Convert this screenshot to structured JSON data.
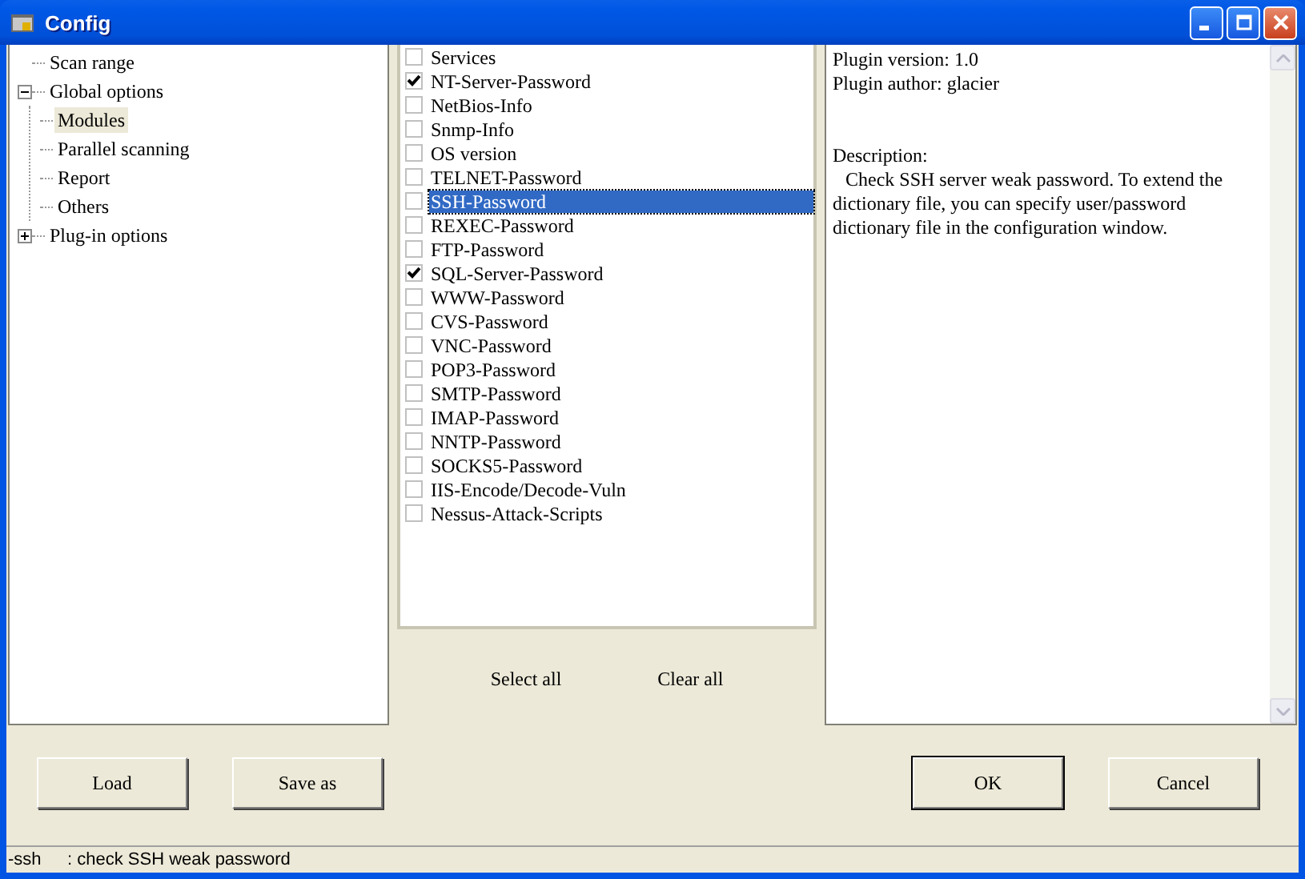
{
  "window": {
    "title": "Config"
  },
  "tree": [
    {
      "label": "Scan range",
      "selected": false
    },
    {
      "label": "Global options",
      "selected": false,
      "expanded": true,
      "children": [
        {
          "label": "Modules",
          "selected": true
        },
        {
          "label": "Parallel scanning",
          "selected": false
        },
        {
          "label": "Report",
          "selected": false
        },
        {
          "label": "Others",
          "selected": false
        }
      ]
    },
    {
      "label": "Plug-in options",
      "selected": false,
      "expanded": false
    }
  ],
  "modules": [
    {
      "label": "Services",
      "checked": false,
      "selected": false
    },
    {
      "label": "NT-Server-Password",
      "checked": true,
      "selected": false
    },
    {
      "label": "NetBios-Info",
      "checked": false,
      "selected": false
    },
    {
      "label": "Snmp-Info",
      "checked": false,
      "selected": false
    },
    {
      "label": "OS version",
      "checked": false,
      "selected": false
    },
    {
      "label": "TELNET-Password",
      "checked": false,
      "selected": false
    },
    {
      "label": "SSH-Password",
      "checked": false,
      "selected": true
    },
    {
      "label": "REXEC-Password",
      "checked": false,
      "selected": false
    },
    {
      "label": "FTP-Password",
      "checked": false,
      "selected": false
    },
    {
      "label": "SQL-Server-Password",
      "checked": true,
      "selected": false
    },
    {
      "label": "WWW-Password",
      "checked": false,
      "selected": false
    },
    {
      "label": "CVS-Password",
      "checked": false,
      "selected": false
    },
    {
      "label": "VNC-Password",
      "checked": false,
      "selected": false
    },
    {
      "label": "POP3-Password",
      "checked": false,
      "selected": false
    },
    {
      "label": "SMTP-Password",
      "checked": false,
      "selected": false
    },
    {
      "label": "IMAP-Password",
      "checked": false,
      "selected": false
    },
    {
      "label": "NNTP-Password",
      "checked": false,
      "selected": false
    },
    {
      "label": "SOCKS5-Password",
      "checked": false,
      "selected": false
    },
    {
      "label": "IIS-Encode/Decode-Vuln",
      "checked": false,
      "selected": false
    },
    {
      "label": "Nessus-Attack-Scripts",
      "checked": false,
      "selected": false
    }
  ],
  "list_buttons": [
    "Select all",
    "Clear all"
  ],
  "info": {
    "version": "Plugin version: 1.0",
    "author": "Plugin author: glacier",
    "description_label": "Description:",
    "description": "Check SSH server weak password. To extend the dictionary file, you can specify user/password dictionary file in the configuration window."
  },
  "buttons": [
    {
      "label": "Load",
      "default": false
    },
    {
      "label": "Save as",
      "default": false
    },
    {
      "label": "OK",
      "default": true
    },
    {
      "label": "Cancel",
      "default": false
    }
  ],
  "status_bar": {
    "key": "-ssh",
    "text": ": check SSH weak password"
  }
}
